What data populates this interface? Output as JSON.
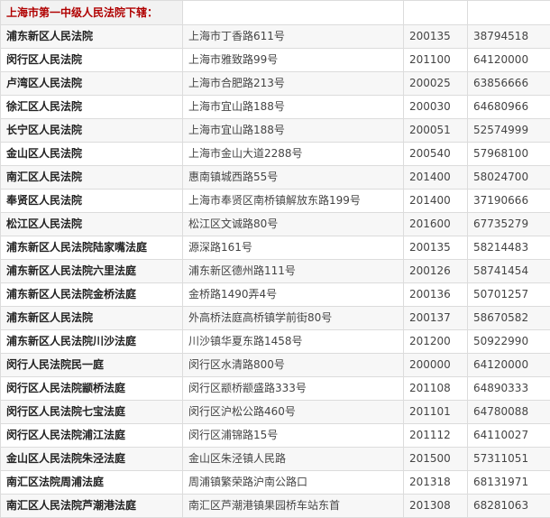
{
  "heading": "上海市第一中级人民法院下辖：",
  "courts": [
    {
      "name": "浦东新区人民法院",
      "address": "上海市丁香路611号",
      "zip": "200135",
      "phone": "38794518"
    },
    {
      "name": "闵行区人民法院",
      "address": "上海市雅致路99号",
      "zip": "201100",
      "phone": "64120000"
    },
    {
      "name": "卢湾区人民法院",
      "address": "上海市合肥路213号",
      "zip": "200025",
      "phone": "63856666"
    },
    {
      "name": "徐汇区人民法院",
      "address": "上海市宜山路188号",
      "zip": "200030",
      "phone": "64680966"
    },
    {
      "name": "长宁区人民法院",
      "address": "上海市宜山路188号",
      "zip": "200051",
      "phone": "52574999"
    },
    {
      "name": "金山区人民法院",
      "address": "上海市金山大道2288号",
      "zip": "200540",
      "phone": "57968100"
    },
    {
      "name": "南汇区人民法院",
      "address": "惠南镇城西路55号",
      "zip": "201400",
      "phone": "58024700"
    },
    {
      "name": "奉贤区人民法院",
      "address": "上海市奉贤区南桥镇解放东路199号",
      "zip": "201400",
      "phone": "37190666"
    },
    {
      "name": "松江区人民法院",
      "address": "松江区文诚路80号",
      "zip": "201600",
      "phone": "67735279"
    },
    {
      "name": "浦东新区人民法院陆家嘴法庭",
      "address": "源深路161号",
      "zip": "200135",
      "phone": "58214483"
    },
    {
      "name": "浦东新区人民法院六里法庭",
      "address": "浦东新区德州路111号",
      "zip": "200126",
      "phone": "58741454"
    },
    {
      "name": "浦东新区人民法院金桥法庭",
      "address": "金桥路1490弄4号",
      "zip": "200136",
      "phone": "50701257"
    },
    {
      "name": "浦东新区人民法院",
      "address": "外高桥法庭高桥镇学前街80号",
      "zip": "200137",
      "phone": "58670582"
    },
    {
      "name": "浦东新区人民法院川沙法庭",
      "address": "川沙镇华夏东路1458号",
      "zip": "201200",
      "phone": "50922990"
    },
    {
      "name": "闵行人民法院民一庭",
      "address": "闵行区水清路800号",
      "zip": "200000",
      "phone": "64120000"
    },
    {
      "name": "闵行区人民法院颛桥法庭",
      "address": "闵行区颛桥颛盛路333号",
      "zip": "201108",
      "phone": "64890333"
    },
    {
      "name": "闵行区人民法院七宝法庭",
      "address": "闵行区沪松公路460号",
      "zip": "201101",
      "phone": "64780088"
    },
    {
      "name": "闵行区人民法院浦江法庭",
      "address": "闵行区浦锦路15号",
      "zip": "201112",
      "phone": "64110027"
    },
    {
      "name": "金山区人民法院朱泾法庭",
      "address": "金山区朱泾镇人民路",
      "zip": "201500",
      "phone": "57311051"
    },
    {
      "name": "南汇区法院周浦法庭",
      "address": "周浦镇繁荣路沪南公路口",
      "zip": "201318",
      "phone": "68131971"
    },
    {
      "name": "南汇区人民法院芦潮港法庭",
      "address": "南汇区芦潮港镇果园桥车站东首",
      "zip": "201308",
      "phone": "68281063"
    }
  ]
}
